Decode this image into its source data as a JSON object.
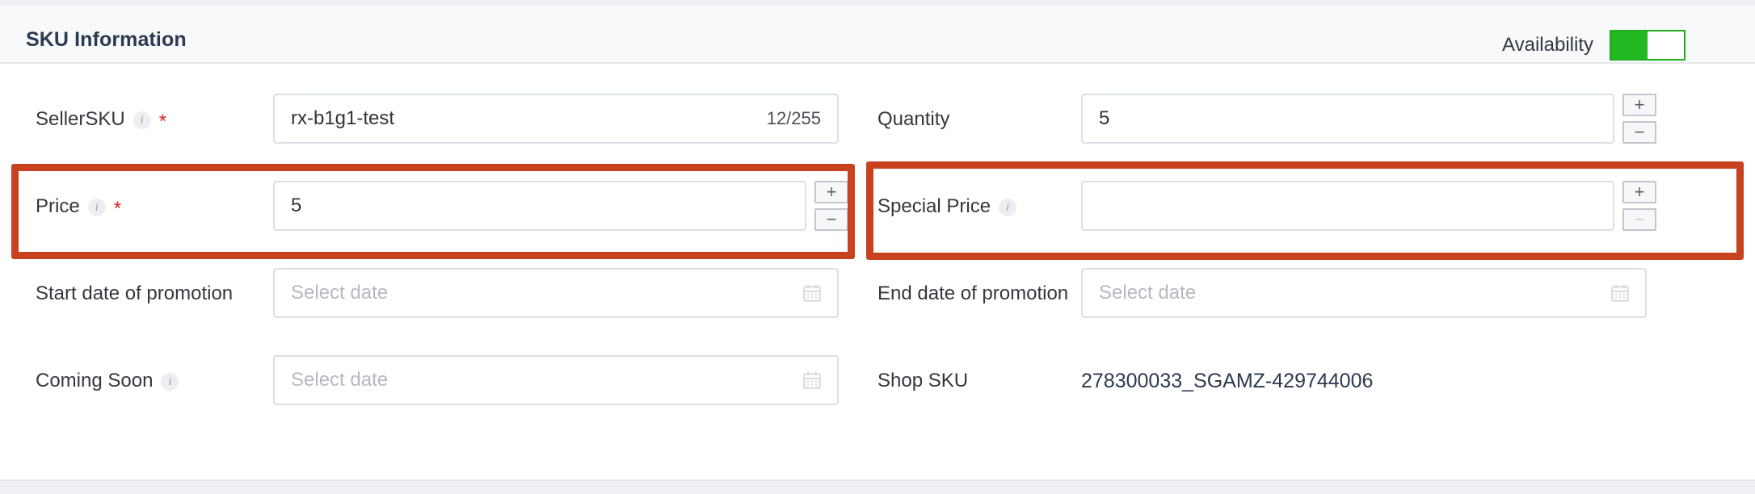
{
  "card": {
    "title": "SKU Information",
    "availability": {
      "label": "Availability",
      "state": "on",
      "on_color": "#22b822",
      "border_color": "#22ac22"
    }
  },
  "annotations": {
    "color": "#c8421f",
    "boxes": [
      "price-field",
      "special-price-field"
    ]
  },
  "fields": {
    "seller_sku": {
      "label": "SellerSKU",
      "required": true,
      "has_info": true,
      "value": "rx-b1g1-test",
      "counter": "12/255"
    },
    "quantity": {
      "label": "Quantity",
      "required": false,
      "has_info": false,
      "value": "5",
      "plus": "+",
      "minus": "−"
    },
    "price": {
      "label": "Price",
      "required": true,
      "has_info": true,
      "value": "5",
      "plus": "+",
      "minus": "−"
    },
    "special_price": {
      "label": "Special Price",
      "required": false,
      "has_info": true,
      "value": "",
      "plus": "+",
      "minus": "−"
    },
    "start_date": {
      "label": "Start date of promotion",
      "value": "",
      "placeholder": "Select date"
    },
    "end_date": {
      "label": "End date of promotion",
      "value": "",
      "placeholder": "Select date"
    },
    "coming_soon": {
      "label": "Coming Soon",
      "has_info": true,
      "value": "",
      "placeholder": "Select date"
    },
    "shop_sku": {
      "label": "Shop SKU",
      "value": "278300033_SGAMZ-429744006"
    }
  }
}
